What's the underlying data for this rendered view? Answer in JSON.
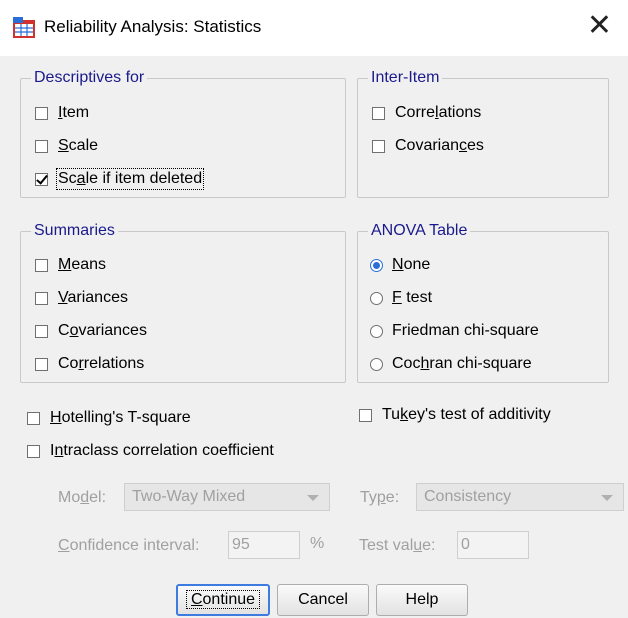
{
  "window": {
    "title": "Reliability Analysis: Statistics"
  },
  "descriptives": {
    "legend": "Descriptives for",
    "items": [
      {
        "pre": "",
        "mn": "I",
        "post": "tem",
        "checked": false
      },
      {
        "pre": "",
        "mn": "S",
        "post": "cale",
        "checked": false
      },
      {
        "pre": "Sc",
        "mn": "a",
        "post": "le if item deleted",
        "checked": true
      }
    ]
  },
  "inter_item": {
    "legend": "Inter-Item",
    "items": [
      {
        "pre": "Corre",
        "mn": "l",
        "post": "ations",
        "checked": false
      },
      {
        "pre": "Covarian",
        "mn": "c",
        "post": "es",
        "checked": false
      }
    ]
  },
  "summaries": {
    "legend": "Summaries",
    "items": [
      {
        "pre": "",
        "mn": "M",
        "post": "eans",
        "checked": false
      },
      {
        "pre": "",
        "mn": "V",
        "post": "ariances",
        "checked": false
      },
      {
        "pre": "C",
        "mn": "o",
        "post": "variances",
        "checked": false
      },
      {
        "pre": "Co",
        "mn": "r",
        "post": "relations",
        "checked": false
      }
    ]
  },
  "anova": {
    "legend": "ANOVA Table",
    "options": [
      {
        "pre": "",
        "mn": "N",
        "post": "one",
        "selected": true
      },
      {
        "pre": "",
        "mn": "F",
        "post": " test",
        "selected": false
      },
      {
        "pre": "Friedman chi-square",
        "mn": "",
        "post": "",
        "selected": false
      },
      {
        "pre": "Coc",
        "mn": "h",
        "post": "ran chi-square",
        "selected": false
      }
    ]
  },
  "hotelling": {
    "pre": "",
    "mn": "H",
    "post": "otelling's T-square",
    "checked": false
  },
  "tukey": {
    "pre": "Tu",
    "mn": "k",
    "post": "ey's test of additivity",
    "checked": false
  },
  "intraclass": {
    "pre": "I",
    "mn": "n",
    "post": "traclass correlation coefficient",
    "checked": false
  },
  "model": {
    "label_pre": "Mo",
    "label_mn": "d",
    "label_post": "el:",
    "value": "Two-Way Mixed"
  },
  "type": {
    "label_pre": "Ty",
    "label_mn": "p",
    "label_post": "e:",
    "value": "Consistency"
  },
  "confidence": {
    "label_pre": "",
    "label_mn": "C",
    "label_post": "onfidence interval:",
    "value": "95",
    "unit": "%"
  },
  "test_value": {
    "label_pre": "Test val",
    "label_mn": "u",
    "label_post": "e:",
    "value": "0"
  },
  "buttons": {
    "continue": {
      "pre": "",
      "mn": "C",
      "post": "ontinue"
    },
    "cancel": "Cancel",
    "help": "Help"
  }
}
